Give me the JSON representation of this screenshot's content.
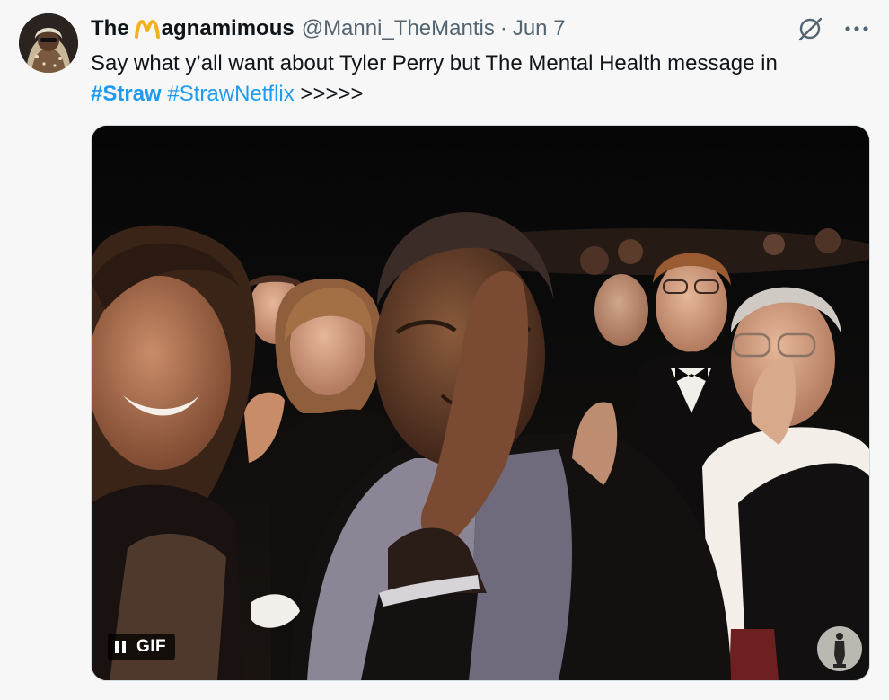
{
  "tweet": {
    "display_name_prefix": "The",
    "display_name_suffix": "agnamimous",
    "display_name_emoji": "m-letter-emoji",
    "handle": "@Manni_TheMantis",
    "separator": "·",
    "date": "Jun 7",
    "text_line1": "Say what y’all want about Tyler Perry but  The Mental Health message in",
    "hashtag1": "#Straw",
    "hashtag2": "#StrawNetflix",
    "text_suffix": ">>>>>",
    "hashtag_color": "#1d9bf0",
    "icons": [
      "grok-slash-icon",
      "more-icon"
    ]
  },
  "media": {
    "badge_label": "GIF",
    "control_icon": "pause-icon",
    "watermark_icon": "oscar-statuette-icon"
  }
}
